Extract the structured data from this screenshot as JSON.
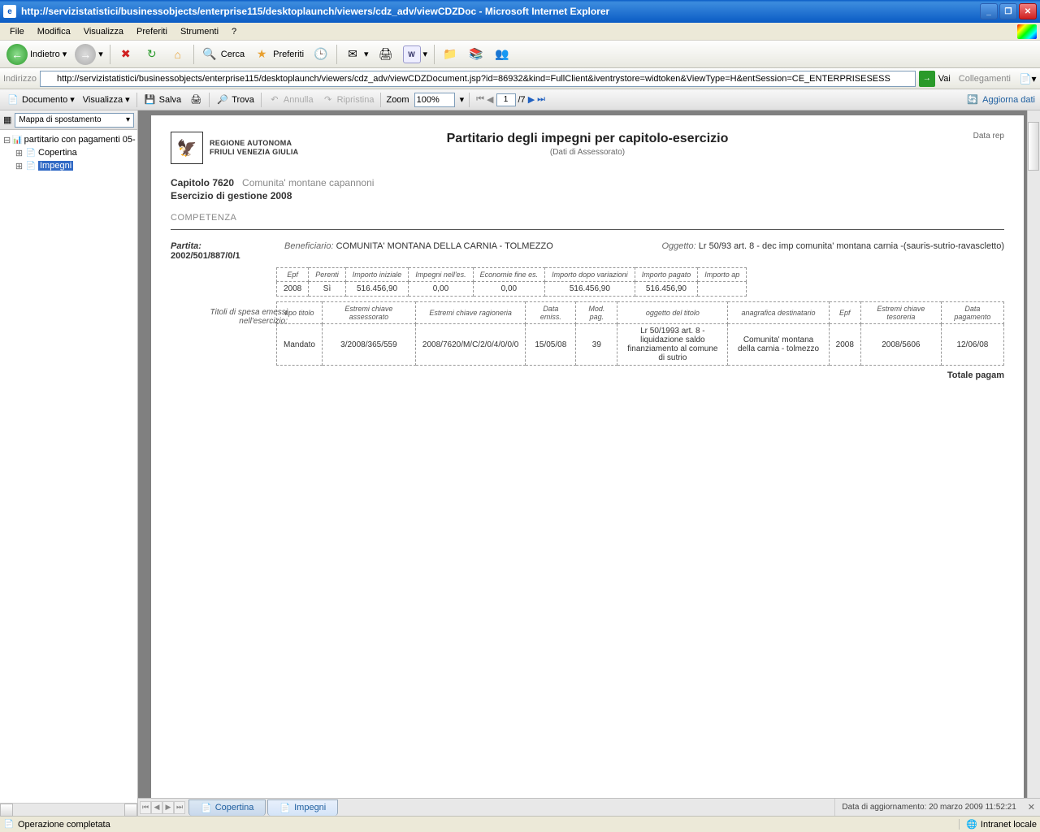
{
  "window": {
    "title": "http://servizistatistici/businessobjects/enterprise115/desktoplaunch/viewers/cdz_adv/viewCDZDoc - Microsoft Internet Explorer"
  },
  "menubar": {
    "file": "File",
    "modifica": "Modifica",
    "visualizza": "Visualizza",
    "preferiti": "Preferiti",
    "strumenti": "Strumenti",
    "help": "?"
  },
  "toolbar": {
    "indietro": "Indietro",
    "cerca": "Cerca",
    "preferiti": "Preferiti"
  },
  "addressbar": {
    "label": "Indirizzo",
    "url": "http://servizistatistici/businessobjects/enterprise115/desktoplaunch/viewers/cdz_adv/viewCDZDocument.jsp?id=86932&kind=FullClient&iventrystore=widtoken&ViewType=H&entSession=CE_ENTERPRISESESS",
    "vai": "Vai",
    "collegamenti": "Collegamenti"
  },
  "vtoolbar": {
    "documento": "Documento",
    "visualizza": "Visualizza",
    "salva": "Salva",
    "trova": "Trova",
    "annulla": "Annulla",
    "ripristina": "Ripristina",
    "zoom_label": "Zoom",
    "zoom_value": "100%",
    "page_value": "1",
    "page_total": "/7",
    "aggiorna": "Aggiorna dati"
  },
  "nav": {
    "dropdown": "Mappa di spostamento",
    "root": "partitario con pagamenti 05-",
    "child1": "Copertina",
    "child2": "Impegni"
  },
  "report": {
    "logo_line1": "REGIONE AUTONOMA",
    "logo_line2": "FRIULI VENEZIA GIULIA",
    "title": "Partitario degli impegni per capitolo-esercizio",
    "subtitle": "(Dati di Assessorato)",
    "datarep": "Data rep",
    "capitolo_label": "Capitolo 7620",
    "capitolo_desc": "Comunita' montane capannoni",
    "esercizio": "Esercizio di gestione 2008",
    "competenza": "COMPETENZA",
    "partita_label": "Partita:",
    "partita_value": "2002/501/887/0/1",
    "benef_label": "Beneficiario:",
    "benef_value": "COMUNITA' MONTANA DELLA CARNIA - TOLMEZZO",
    "oggetto_label": "Oggetto:",
    "oggetto_value": "Lr 50/93 art. 8 - dec imp comunita' montana carnia -(sauris-sutrio-ravascletto)",
    "table1": {
      "headers": [
        "Epf",
        "Perenti",
        "Importo iniziale",
        "Impegni nell'es.",
        "Economie fine es.",
        "Importo dopo variazioni",
        "Importo pagato",
        "Importo ap"
      ],
      "row": [
        "2008",
        "Sì",
        "516.456,90",
        "0,00",
        "0,00",
        "516.456,90",
        "516.456,90",
        ""
      ]
    },
    "titoli_label": "Titoli di spesa emessi nell'esercizio:",
    "table2": {
      "headers": [
        "tipo titolo",
        "Estremi chiave assessorato",
        "Estremi chiave ragioneria",
        "Data emiss.",
        "Mod. pag.",
        "oggetto del titolo",
        "anagrafica destinatario",
        "Epf",
        "Estremi chiave tesoreria",
        "Data pagamento"
      ],
      "row": [
        "Mandato",
        "3/2008/365/559",
        "2008/7620/M/C/2/0/4/0/0/0",
        "15/05/08",
        "39",
        "Lr 50/1993 art. 8 - liquidazione saldo finanziamento al comune di sutrio",
        "Comunita' montana della carnia - tolmezzo",
        "2008",
        "2008/5606",
        "12/06/08"
      ]
    },
    "totale": "Totale pagam"
  },
  "tabs": {
    "copertina": "Copertina",
    "impegni": "Impegni",
    "updated": "Data di aggiornamento: 20 marzo 2009 11:52:21"
  },
  "statusbar": {
    "status": "Operazione completata",
    "zone": "Intranet locale"
  }
}
